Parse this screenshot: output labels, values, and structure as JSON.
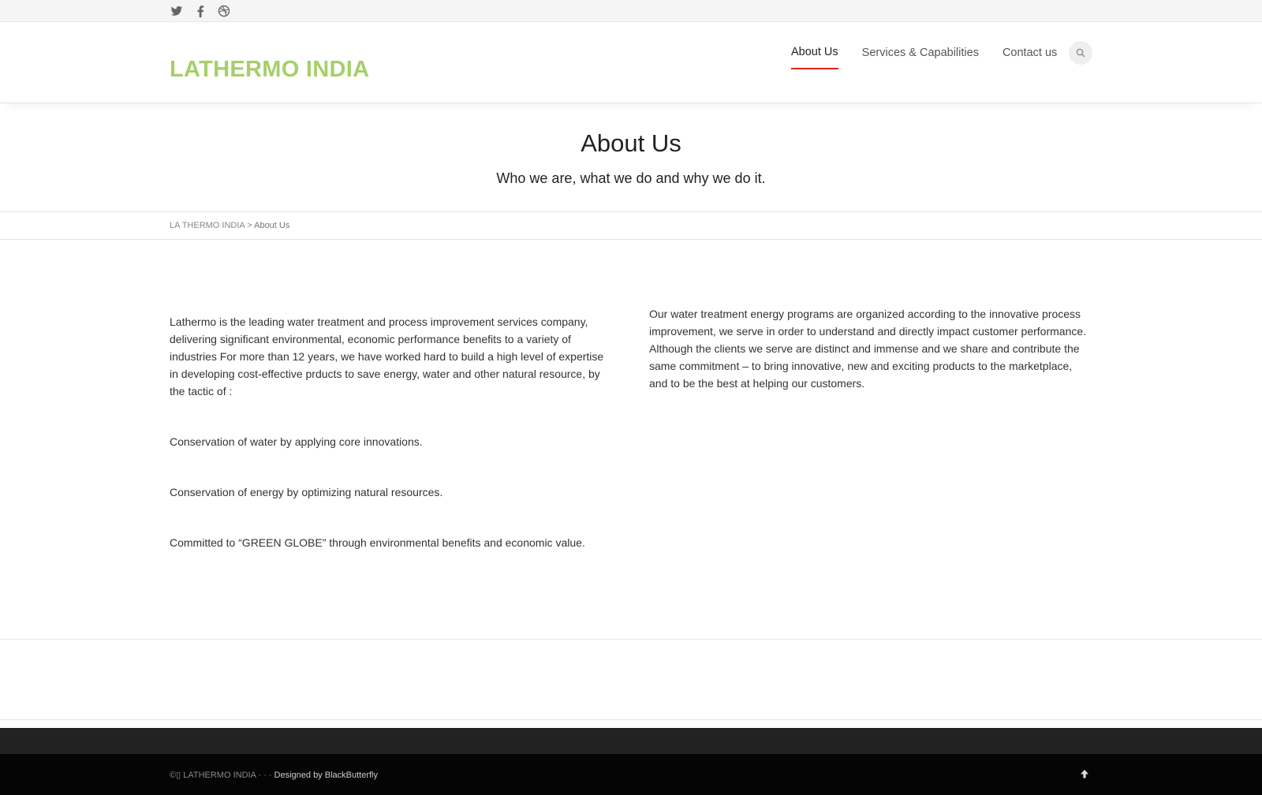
{
  "social": {
    "icons": [
      "twitter-icon",
      "facebook-icon",
      "dribbble-icon"
    ]
  },
  "header": {
    "logo": "LATHERMO INDIA",
    "nav": [
      {
        "label": "About Us",
        "active": true
      },
      {
        "label": "Services & Capabilities",
        "active": false
      },
      {
        "label": "Contact us",
        "active": false
      }
    ],
    "accent": "#e2231a",
    "logo_color": "#a7cf6a"
  },
  "page": {
    "title": "About Us",
    "subtitle": "Who we are, what we do and why we do it."
  },
  "breadcrumb": {
    "home": "LA THERMO INDIA",
    "separator": ">",
    "current": "About Us"
  },
  "content": {
    "left": [
      "Lathermo is the leading water treatment and process improvement services company, delivering significant environmental, economic performance benefits to a variety of industries For more than 12 years, we have worked hard to build a high level of expertise in developing cost-effective prducts to save energy, water and other natural resource, by the tactic of :",
      "Conservation of water by applying  core innovations.",
      "Conservation of energy by optimizing natural resources.",
      "Committed to “GREEN GLOBE”  through environmental benefits and economic value."
    ],
    "right": "Our water treatment energy programs are organized according to the innovative process improvement, we serve in order to understand and directly impact customer performance. Although the clients we serve are distinct and immense and we share and contribute the same commitment – to bring innovative, new and exciting products to the marketplace, and to be the best at helping our customers."
  },
  "footer": {
    "copyright": "©▯ LATHERMO INDIA · · ·",
    "designed": "Designed by BlackButterfly"
  }
}
